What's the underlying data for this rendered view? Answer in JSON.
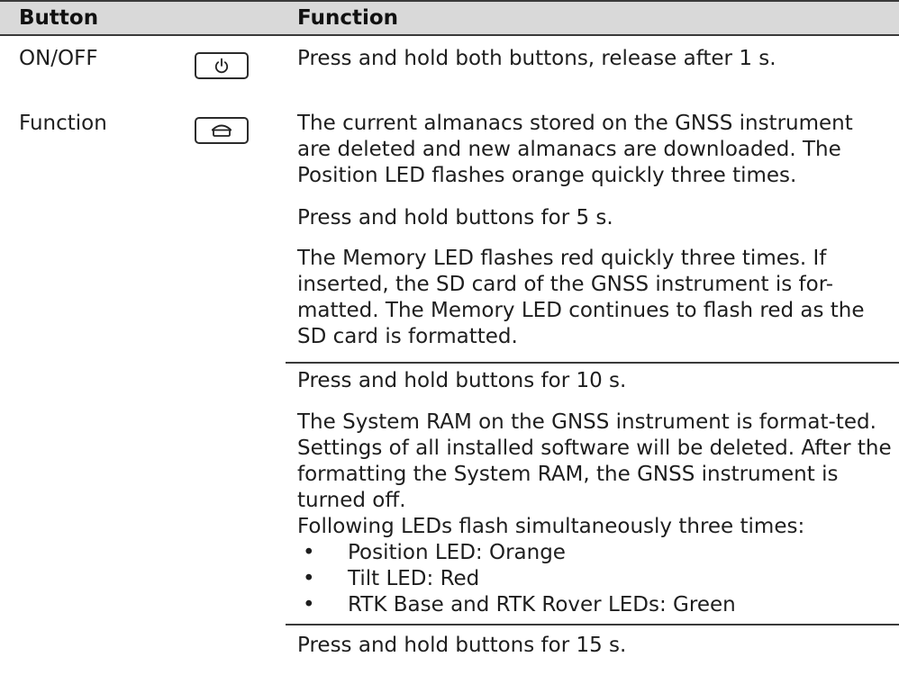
{
  "header": {
    "col1": "Button",
    "col2": "Function"
  },
  "rows": [
    {
      "label": "ON/OFF",
      "icon": "power-icon",
      "text": "Press and hold both buttons, release after 1 s."
    },
    {
      "label": "Function",
      "icon": "function-button-icon",
      "paragraphs": [
        "The current almanacs stored on the GNSS instrument are deleted and new almanacs are downloaded. The Position LED flashes orange quickly three times.",
        "Press and hold buttons for 5 s.",
        "The Memory LED flashes red quickly three times. If inserted, the SD card of the GNSS instrument is for-matted. The Memory LED continues to flash red as the SD card is formatted.",
        "Press and hold buttons for 10 s.",
        "The System RAM on the GNSS instrument is format-ted. Settings of all installed software will be deleted. After the formatting the System RAM, the GNSS instrument is turned off.",
        "Following LEDs flash simultaneously three times:",
        "Press and hold buttons for 15 s."
      ],
      "bullets": [
        "Position LED: Orange",
        "Tilt LED: Red",
        "RTK Base and RTK Rover LEDs: Green"
      ]
    }
  ],
  "bullet_char": "•"
}
